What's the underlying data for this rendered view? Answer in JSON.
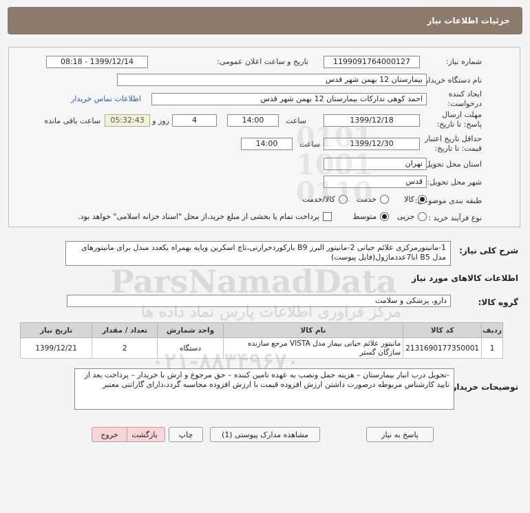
{
  "title": "جزئیات اطلاعات نیاز",
  "labels": {
    "need_number": "شماره نیاز:",
    "announce_datetime": "تاریخ و ساعت اعلان عمومی:",
    "buyer_org": "نام دستگاه خریدار:",
    "requester": "ایجاد کننده درخواست:",
    "deadline": "مهلت ارسال پاسخ: تا تاریخ:",
    "time_word": "ساعت",
    "day_and": "روز و",
    "remaining": "ساعت باقی مانده",
    "validity": "حداقل تاریخ اعتبار قیمت: تا تاریخ:",
    "province": "استان محل تحویل:",
    "city": "شهر محل تحویل:",
    "category": "طبقه بندی موضوعی:",
    "process_type": "نوع فرآیند خرید :",
    "general_desc": "شرح کلی نیاز:",
    "goods_info": "اطلاعات کالاهای مورد نیاز",
    "goods_group": "گروه کالا:",
    "buyer_notes": "توضیحات خریدار:"
  },
  "values": {
    "need_number": "1199091764000127",
    "announce_datetime": "1399/12/14 - 08:18",
    "buyer_org": "بیمارستان 12 بهمن شهر قدس",
    "requester": "احمد کوهی تدارکات بیمارستان 12 بهمن شهر قدس",
    "contact_link": "اطلاعات تماس خریدار",
    "deadline_date": "1399/12/18",
    "deadline_time": "14:00",
    "days": "4",
    "remaining_time": "05:32:43",
    "validity_date": "1399/12/30",
    "validity_time": "14:00",
    "province": "تهران",
    "city": "قدس",
    "general_desc": "1-مانیتورمرکزی علائم حیاتی 2-مانیتور البرز B9 بارکوردحرارتی،تاچ اسکرین وپایه بهمراه یکعدد مبدل برای مانیتورهای مدل B5 ابا7عددماژول(فایل پیوست)",
    "goods_group": "دارو، پزشکی و سلامت",
    "buyer_notes": "-تحویل درب انبار بیمارستان – هزینه حمل ونصب به عهده تامین کننده – حق مرجوع و ارش با خریدار – پرداخت بعد از تایید کارشناس مربوطه درصورت داشتن ارزش افزوده قیمت با ارزش افزوده محاسبه گردد،دارای گارانتی معتبر"
  },
  "category_options": [
    {
      "label": "کالا",
      "selected": true
    },
    {
      "label": "خدمت",
      "selected": false
    },
    {
      "label": "کالا/خدمت",
      "selected": false
    }
  ],
  "process_options": [
    {
      "label": "جزیی",
      "selected": false
    },
    {
      "label": "متوسط",
      "selected": true
    }
  ],
  "treasury_note": "پرداخت تمام یا بخشی از مبلغ خرید،از محل \"اسناد خزانه اسلامی\" خواهد بود.",
  "table": {
    "headers": [
      "ردیف",
      "کد کالا",
      "نام کالا",
      "واحد شمارش",
      "تعداد / مقدار",
      "تاریخ نیاز"
    ],
    "rows": [
      [
        "1",
        "2131690177350001",
        "مانیتور علائم حیاتی بیمار مدل VISTA مرجع سازنده سازگان گستر",
        "دستگاه",
        "2",
        "1399/12/21"
      ]
    ]
  },
  "buttons": {
    "reply": "پاسخ به نیاز",
    "attachments": "مشاهده مدارک پیوستی (1)",
    "print": "چاپ",
    "back": "بازگشت",
    "exit": "خروج"
  },
  "watermark": {
    "brand": "ParsNamadData",
    "persian": "مرکز فراوری اطلاعات پارس نماد داده ها",
    "phone": "۰۲۱-۸۸۳۴۹۶۷۰"
  }
}
